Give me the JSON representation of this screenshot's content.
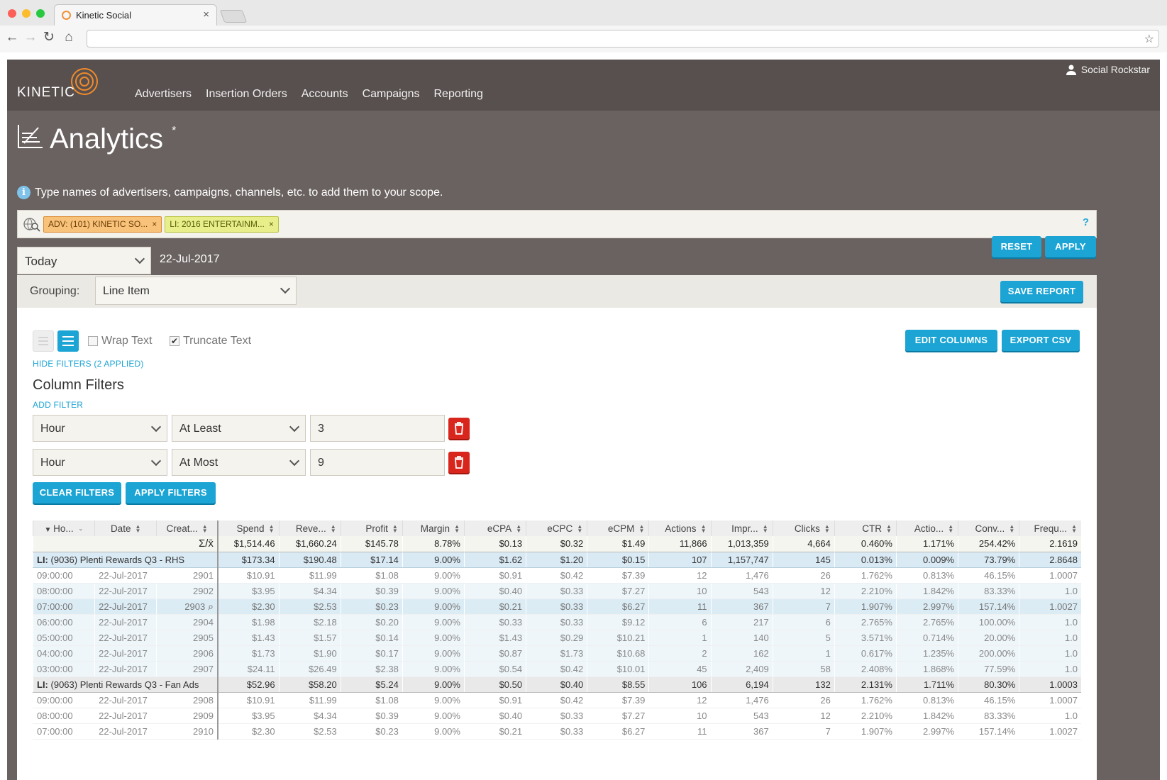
{
  "browser": {
    "tab_title": "Kinetic Social",
    "url": ""
  },
  "colors": {
    "accent": "#1ba4d4",
    "header_bg": "#58504e",
    "body_bg": "#6a6260",
    "danger": "#d9261c"
  },
  "nav": {
    "logo": "KINETIC",
    "links": [
      "Advertisers",
      "Insertion Orders",
      "Accounts",
      "Campaigns",
      "Reporting"
    ],
    "user": "Social Rockstar"
  },
  "page": {
    "title": "Analytics",
    "title_marker": "*",
    "info": "Type names of advertisers, campaigns, channels, etc. to add them to your scope."
  },
  "scope": {
    "chips": [
      {
        "label": "ADV: (101) KINETIC SO...",
        "type": "adv"
      },
      {
        "label": "LI: 2016 ENTERTAINM...",
        "type": "li"
      }
    ],
    "help": "?"
  },
  "date_range": {
    "selected": "Today",
    "date": "22-Jul-2017"
  },
  "buttons": {
    "reset": "RESET",
    "apply": "APPLY",
    "save_report": "SAVE REPORT",
    "edit_columns": "EDIT COLUMNS",
    "export_csv": "EXPORT CSV",
    "clear_filters": "CLEAR FILTERS",
    "apply_filters": "APPLY FILTERS"
  },
  "grouping": {
    "label": "Grouping:",
    "selected": "Line Item"
  },
  "view": {
    "wrap_text": "Wrap Text",
    "truncate_text": "Truncate Text",
    "truncate_checked": true
  },
  "filters": {
    "toggle_link": "HIDE FILTERS (2 APPLIED)",
    "title": "Column Filters",
    "add_link": "ADD FILTER",
    "items": [
      {
        "column": "Hour",
        "operator": "At Least",
        "value": "3"
      },
      {
        "column": "Hour",
        "operator": "At Most",
        "value": "9"
      }
    ]
  },
  "table": {
    "headers": [
      "Ho...",
      "Date",
      "Creat...",
      "Spend",
      "Reve...",
      "Profit",
      "Margin",
      "eCPA",
      "eCPC",
      "eCPM",
      "Actions",
      "Impr...",
      "Clicks",
      "CTR",
      "Actio...",
      "Conv...",
      "Frequ..."
    ],
    "totals_symbol": "Σ/x̄",
    "totals": [
      "$1,514.46",
      "$1,660.24",
      "$145.78",
      "8.78%",
      "$0.13",
      "$0.32",
      "$1.49",
      "11,866",
      "1,013,359",
      "4,664",
      "0.460%",
      "1.171%",
      "254.42%",
      "2.1619"
    ],
    "groups": [
      {
        "prefix": "LI:",
        "name": "(9036) Plenti Rewards Q3 - RHS",
        "values": [
          "$173.34",
          "$190.48",
          "$17.14",
          "9.00%",
          "$1.62",
          "$1.20",
          "$0.15",
          "107",
          "1,157,747",
          "145",
          "0.013%",
          "0.009%",
          "73.79%",
          "2.8648"
        ],
        "rows": [
          [
            "09:00:00",
            "22-Jul-2017",
            "2901",
            "$10.91",
            "$11.99",
            "$1.08",
            "9.00%",
            "$0.91",
            "$0.42",
            "$7.39",
            "12",
            "1,476",
            "26",
            "1.762%",
            "0.813%",
            "46.15%",
            "1.0007"
          ],
          [
            "08:00:00",
            "22-Jul-2017",
            "2902",
            "$3.95",
            "$4.34",
            "$0.39",
            "9.00%",
            "$0.40",
            "$0.33",
            "$7.27",
            "10",
            "543",
            "12",
            "2.210%",
            "1.842%",
            "83.33%",
            "1.0"
          ],
          [
            "07:00:00",
            "22-Jul-2017",
            "2903",
            "$2.30",
            "$2.53",
            "$0.23",
            "9.00%",
            "$0.21",
            "$0.33",
            "$6.27",
            "11",
            "367",
            "7",
            "1.907%",
            "2.997%",
            "157.14%",
            "1.0027"
          ],
          [
            "06:00:00",
            "22-Jul-2017",
            "2904",
            "$1.98",
            "$2.18",
            "$0.20",
            "9.00%",
            "$0.33",
            "$0.33",
            "$9.12",
            "6",
            "217",
            "6",
            "2.765%",
            "2.765%",
            "100.00%",
            "1.0"
          ],
          [
            "05:00:00",
            "22-Jul-2017",
            "2905",
            "$1.43",
            "$1.57",
            "$0.14",
            "9.00%",
            "$1.43",
            "$0.29",
            "$10.21",
            "1",
            "140",
            "5",
            "3.571%",
            "0.714%",
            "20.00%",
            "1.0"
          ],
          [
            "04:00:00",
            "22-Jul-2017",
            "2906",
            "$1.73",
            "$1.90",
            "$0.17",
            "9.00%",
            "$0.87",
            "$1.73",
            "$10.68",
            "2",
            "162",
            "1",
            "0.617%",
            "1.235%",
            "200.00%",
            "1.0"
          ],
          [
            "03:00:00",
            "22-Jul-2017",
            "2907",
            "$24.11",
            "$26.49",
            "$2.38",
            "9.00%",
            "$0.54",
            "$0.42",
            "$10.01",
            "45",
            "2,409",
            "58",
            "2.408%",
            "1.868%",
            "77.59%",
            "1.0"
          ]
        ]
      },
      {
        "prefix": "LI:",
        "name": "(9063) Plenti Rewards Q3 - Fan Ads",
        "values": [
          "$52.96",
          "$58.20",
          "$5.24",
          "9.00%",
          "$0.50",
          "$0.40",
          "$8.55",
          "106",
          "6,194",
          "132",
          "2.131%",
          "1.711%",
          "80.30%",
          "1.0003"
        ],
        "rows": [
          [
            "09:00:00",
            "22-Jul-2017",
            "2908",
            "$10.91",
            "$11.99",
            "$1.08",
            "9.00%",
            "$0.91",
            "$0.42",
            "$7.39",
            "12",
            "1,476",
            "26",
            "1.762%",
            "0.813%",
            "46.15%",
            "1.0007"
          ],
          [
            "08:00:00",
            "22-Jul-2017",
            "2909",
            "$3.95",
            "$4.34",
            "$0.39",
            "9.00%",
            "$0.40",
            "$0.33",
            "$7.27",
            "10",
            "543",
            "12",
            "2.210%",
            "1.842%",
            "83.33%",
            "1.0"
          ],
          [
            "07:00:00",
            "22-Jul-2017",
            "2910",
            "$2.30",
            "$2.53",
            "$0.23",
            "9.00%",
            "$0.21",
            "$0.33",
            "$6.27",
            "11",
            "367",
            "7",
            "1.907%",
            "2.997%",
            "157.14%",
            "1.0027"
          ]
        ]
      }
    ]
  }
}
